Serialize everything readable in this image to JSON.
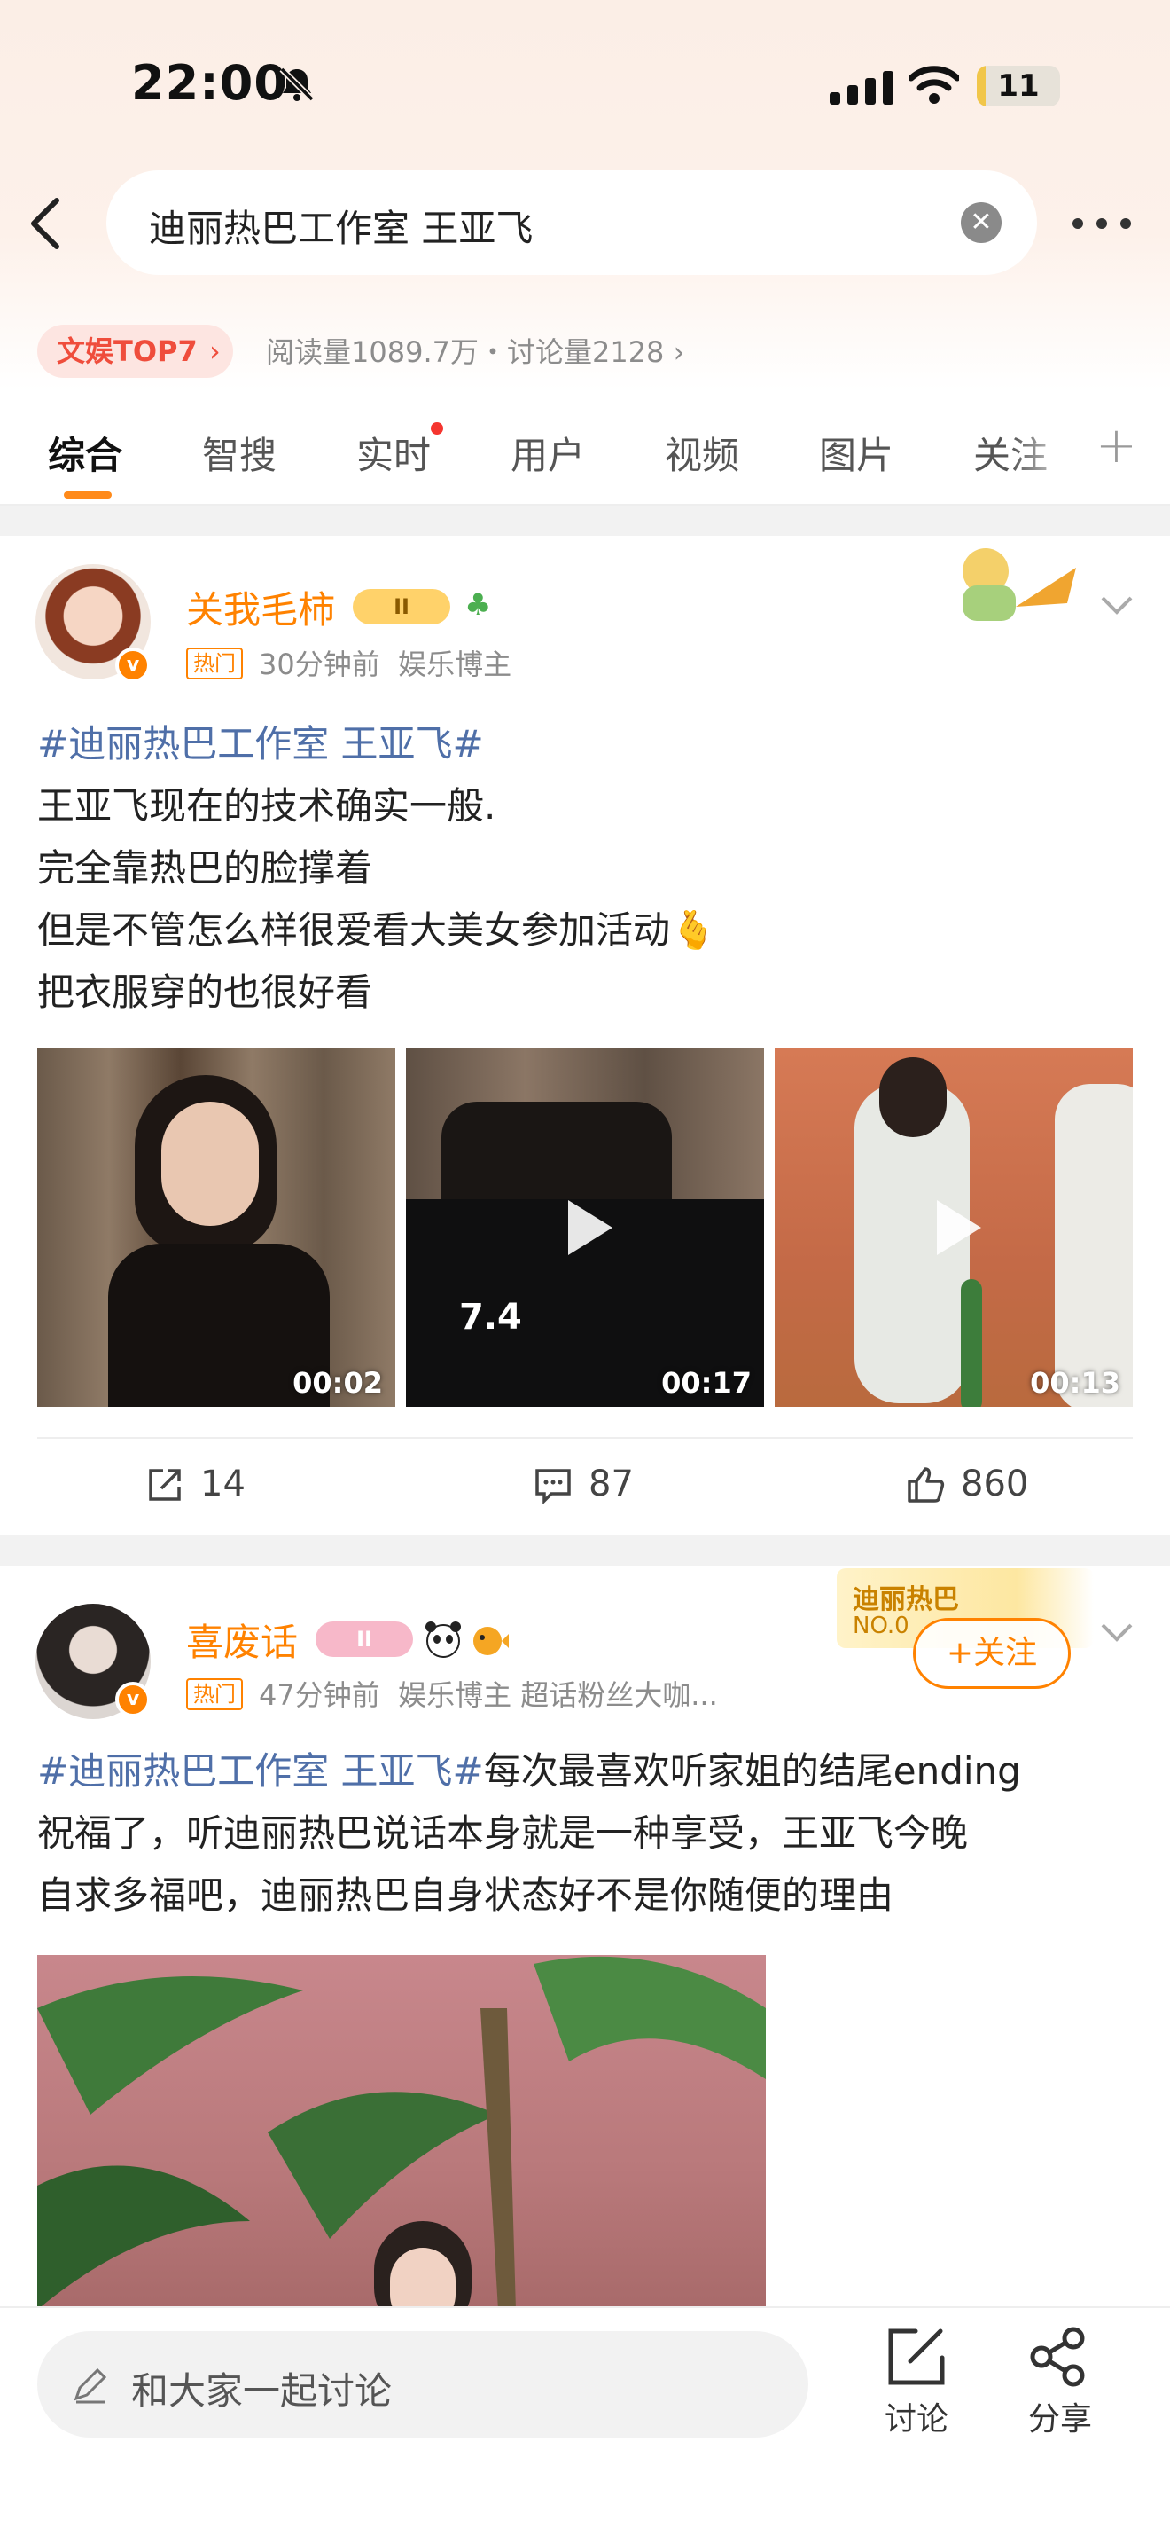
{
  "status_bar": {
    "time": "22:00",
    "battery": "11",
    "battery_level": 0.11
  },
  "search": {
    "query": "迪丽热巴工作室 王亚飞"
  },
  "topic_info": {
    "rank_badge": "文娱TOP7",
    "stats": "阅读量1089.7万・讨论量2128"
  },
  "tabs": [
    {
      "label": "综合",
      "active": true
    },
    {
      "label": "智搜"
    },
    {
      "label": "实时",
      "has_dot": true
    },
    {
      "label": "用户"
    },
    {
      "label": "视频"
    },
    {
      "label": "图片"
    },
    {
      "label": "关注"
    }
  ],
  "posts": [
    {
      "username": "关我毛柿",
      "level_badge": "II",
      "hot_tag": "热门",
      "time": "30分钟前",
      "category": "娱乐博主",
      "hashtag": "#迪丽热巴工作室 王亚飞#",
      "lines": [
        "王亚飞现在的技术确实一般.",
        "完全靠热巴的脸撑着",
        "但是不管怎么样很爱看大美女参加活动",
        "把衣服穿的也很好看"
      ],
      "emoji": "🫰",
      "videos": [
        {
          "duration": "00:02"
        },
        {
          "duration": "00:17"
        },
        {
          "duration": "00:13"
        }
      ],
      "shares": "14",
      "comments": "87",
      "likes": "860"
    },
    {
      "username": "喜废话",
      "level_badge": "II",
      "hot_tag": "热门",
      "time": "47分钟前",
      "category": "娱乐博主 超话粉丝大咖...",
      "fan_badge_name": "迪丽热巴",
      "fan_badge_no": "NO.0",
      "follow_label": "+关注",
      "hashtag": "#迪丽热巴工作室 王亚飞#",
      "text_after_tag": "每次最喜欢听家姐的结尾ending",
      "lines": [
        "祝福了，听迪丽热巴说话本身就是一种享受，王亚飞今晚",
        "自求多福吧，迪丽热巴自身状态好不是你随便的理由"
      ]
    }
  ],
  "bottom": {
    "input_placeholder": "和大家一起讨论",
    "discuss_label": "讨论",
    "share_label": "分享"
  },
  "colors": {
    "accent": "#ff8200",
    "hashtag": "#4f6fa8",
    "rank_red": "#ef4d3c",
    "tab_underline": "#ff8a1a"
  }
}
